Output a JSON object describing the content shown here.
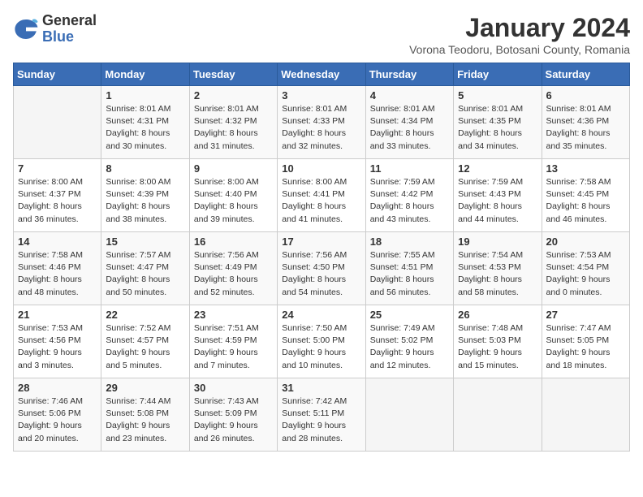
{
  "logo": {
    "general": "General",
    "blue": "Blue"
  },
  "header": {
    "month": "January 2024",
    "location": "Vorona Teodoru, Botosani County, Romania"
  },
  "weekdays": [
    "Sunday",
    "Monday",
    "Tuesday",
    "Wednesday",
    "Thursday",
    "Friday",
    "Saturday"
  ],
  "weeks": [
    [
      {
        "day": "",
        "info": ""
      },
      {
        "day": "1",
        "info": "Sunrise: 8:01 AM\nSunset: 4:31 PM\nDaylight: 8 hours\nand 30 minutes."
      },
      {
        "day": "2",
        "info": "Sunrise: 8:01 AM\nSunset: 4:32 PM\nDaylight: 8 hours\nand 31 minutes."
      },
      {
        "day": "3",
        "info": "Sunrise: 8:01 AM\nSunset: 4:33 PM\nDaylight: 8 hours\nand 32 minutes."
      },
      {
        "day": "4",
        "info": "Sunrise: 8:01 AM\nSunset: 4:34 PM\nDaylight: 8 hours\nand 33 minutes."
      },
      {
        "day": "5",
        "info": "Sunrise: 8:01 AM\nSunset: 4:35 PM\nDaylight: 8 hours\nand 34 minutes."
      },
      {
        "day": "6",
        "info": "Sunrise: 8:01 AM\nSunset: 4:36 PM\nDaylight: 8 hours\nand 35 minutes."
      }
    ],
    [
      {
        "day": "7",
        "info": "Sunrise: 8:00 AM\nSunset: 4:37 PM\nDaylight: 8 hours\nand 36 minutes."
      },
      {
        "day": "8",
        "info": "Sunrise: 8:00 AM\nSunset: 4:39 PM\nDaylight: 8 hours\nand 38 minutes."
      },
      {
        "day": "9",
        "info": "Sunrise: 8:00 AM\nSunset: 4:40 PM\nDaylight: 8 hours\nand 39 minutes."
      },
      {
        "day": "10",
        "info": "Sunrise: 8:00 AM\nSunset: 4:41 PM\nDaylight: 8 hours\nand 41 minutes."
      },
      {
        "day": "11",
        "info": "Sunrise: 7:59 AM\nSunset: 4:42 PM\nDaylight: 8 hours\nand 43 minutes."
      },
      {
        "day": "12",
        "info": "Sunrise: 7:59 AM\nSunset: 4:43 PM\nDaylight: 8 hours\nand 44 minutes."
      },
      {
        "day": "13",
        "info": "Sunrise: 7:58 AM\nSunset: 4:45 PM\nDaylight: 8 hours\nand 46 minutes."
      }
    ],
    [
      {
        "day": "14",
        "info": "Sunrise: 7:58 AM\nSunset: 4:46 PM\nDaylight: 8 hours\nand 48 minutes."
      },
      {
        "day": "15",
        "info": "Sunrise: 7:57 AM\nSunset: 4:47 PM\nDaylight: 8 hours\nand 50 minutes."
      },
      {
        "day": "16",
        "info": "Sunrise: 7:56 AM\nSunset: 4:49 PM\nDaylight: 8 hours\nand 52 minutes."
      },
      {
        "day": "17",
        "info": "Sunrise: 7:56 AM\nSunset: 4:50 PM\nDaylight: 8 hours\nand 54 minutes."
      },
      {
        "day": "18",
        "info": "Sunrise: 7:55 AM\nSunset: 4:51 PM\nDaylight: 8 hours\nand 56 minutes."
      },
      {
        "day": "19",
        "info": "Sunrise: 7:54 AM\nSunset: 4:53 PM\nDaylight: 8 hours\nand 58 minutes."
      },
      {
        "day": "20",
        "info": "Sunrise: 7:53 AM\nSunset: 4:54 PM\nDaylight: 9 hours\nand 0 minutes."
      }
    ],
    [
      {
        "day": "21",
        "info": "Sunrise: 7:53 AM\nSunset: 4:56 PM\nDaylight: 9 hours\nand 3 minutes."
      },
      {
        "day": "22",
        "info": "Sunrise: 7:52 AM\nSunset: 4:57 PM\nDaylight: 9 hours\nand 5 minutes."
      },
      {
        "day": "23",
        "info": "Sunrise: 7:51 AM\nSunset: 4:59 PM\nDaylight: 9 hours\nand 7 minutes."
      },
      {
        "day": "24",
        "info": "Sunrise: 7:50 AM\nSunset: 5:00 PM\nDaylight: 9 hours\nand 10 minutes."
      },
      {
        "day": "25",
        "info": "Sunrise: 7:49 AM\nSunset: 5:02 PM\nDaylight: 9 hours\nand 12 minutes."
      },
      {
        "day": "26",
        "info": "Sunrise: 7:48 AM\nSunset: 5:03 PM\nDaylight: 9 hours\nand 15 minutes."
      },
      {
        "day": "27",
        "info": "Sunrise: 7:47 AM\nSunset: 5:05 PM\nDaylight: 9 hours\nand 18 minutes."
      }
    ],
    [
      {
        "day": "28",
        "info": "Sunrise: 7:46 AM\nSunset: 5:06 PM\nDaylight: 9 hours\nand 20 minutes."
      },
      {
        "day": "29",
        "info": "Sunrise: 7:44 AM\nSunset: 5:08 PM\nDaylight: 9 hours\nand 23 minutes."
      },
      {
        "day": "30",
        "info": "Sunrise: 7:43 AM\nSunset: 5:09 PM\nDaylight: 9 hours\nand 26 minutes."
      },
      {
        "day": "31",
        "info": "Sunrise: 7:42 AM\nSunset: 5:11 PM\nDaylight: 9 hours\nand 28 minutes."
      },
      {
        "day": "",
        "info": ""
      },
      {
        "day": "",
        "info": ""
      },
      {
        "day": "",
        "info": ""
      }
    ]
  ]
}
